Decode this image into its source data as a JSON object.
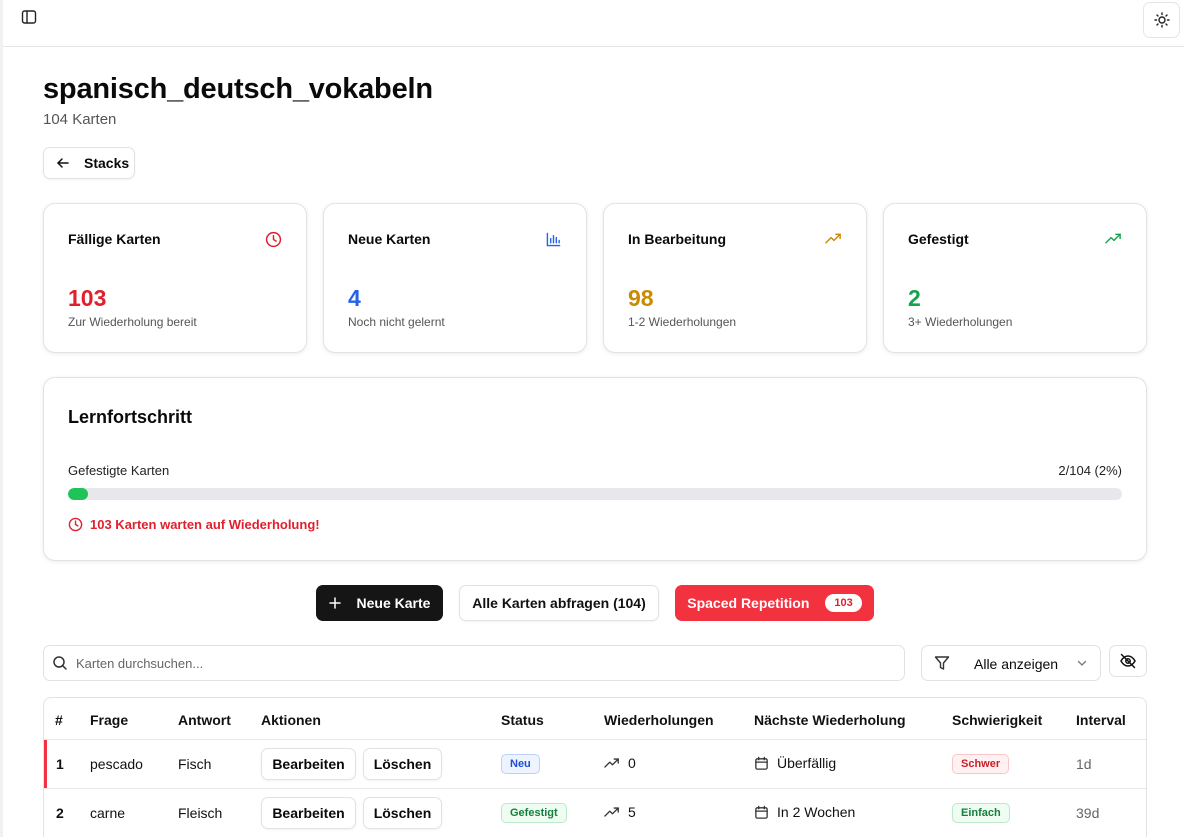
{
  "page": {
    "title": "spanisch_deutsch_vokabeln",
    "subtitle": "104 Karten",
    "back_label": "Stacks"
  },
  "stats": [
    {
      "title": "Fällige Karten",
      "value": "103",
      "desc": "Zur Wiederholung bereit",
      "color": "#e0202d",
      "icon": "clock-icon"
    },
    {
      "title": "Neue Karten",
      "value": "4",
      "desc": "Noch nicht gelernt",
      "color": "#2563eb",
      "icon": "bar-chart-icon"
    },
    {
      "title": "In Bearbeitung",
      "value": "98",
      "desc": "1-2 Wiederholungen",
      "color": "#ca8a04",
      "icon": "trending-up-icon"
    },
    {
      "title": "Gefestigt",
      "value": "2",
      "desc": "3+ Wiederholungen",
      "color": "#16a34a",
      "icon": "trending-up-icon"
    }
  ],
  "progress": {
    "title": "Lernfortschritt",
    "label": "Gefestigte Karten",
    "value_text": "2/104 (2%)",
    "fraction": 0.019,
    "warning": "103 Karten warten auf Wiederholung!"
  },
  "actions": {
    "new_card": "Neue Karte",
    "query_all": "Alle Karten abfragen (104)",
    "spaced": "Spaced Repetition",
    "spaced_count": "103"
  },
  "search": {
    "placeholder": "Karten durchsuchen..."
  },
  "filter": {
    "selected": "Alle anzeigen"
  },
  "table": {
    "headers": [
      "#",
      "Frage",
      "Antwort",
      "Aktionen",
      "Status",
      "Wiederholungen",
      "Nächste Wiederholung",
      "Schwierigkeit",
      "Interval"
    ],
    "edit_label": "Bearbeiten",
    "delete_label": "Löschen",
    "rows": [
      {
        "num": "1",
        "frage": "pescado",
        "antwort": "Fisch",
        "status": "Neu",
        "reps": "0",
        "next": "Überfällig",
        "difficulty": "Schwer",
        "interval": "1d"
      },
      {
        "num": "2",
        "frage": "carne",
        "antwort": "Fleisch",
        "status": "Gefestigt",
        "reps": "5",
        "next": "In 2 Wochen",
        "difficulty": "Einfach",
        "interval": "39d"
      }
    ]
  }
}
